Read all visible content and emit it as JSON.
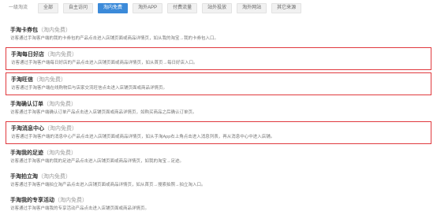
{
  "tabs": [
    {
      "label": "一级淘流",
      "active": false
    },
    {
      "label": "全部",
      "active": false
    },
    {
      "label": "自主访问",
      "active": false
    },
    {
      "label": "淘内免费",
      "active": true
    },
    {
      "label": "淘外APP",
      "active": false
    },
    {
      "label": "付费流量",
      "active": false
    },
    {
      "label": "站外投放",
      "active": false
    },
    {
      "label": "淘外网站",
      "active": false
    },
    {
      "label": "其它来源",
      "active": false
    }
  ],
  "items": [
    {
      "title": "手淘卡券包",
      "tag": "（淘内免费）",
      "desc": "访客通过手淘客户端的我的卡券包的产品点击进入店铺页面或商品详情页，如从我的淘宝→我的卡券包入口。",
      "highlighted": false
    },
    {
      "title": "手淘每日好店",
      "tag": "（淘内免费）",
      "desc": "访客通过手淘客户端每日好店的产品点击进入店铺页面或商品详情页，如从首页→每日好店入口。",
      "highlighted": true
    },
    {
      "title": "手淘旺信",
      "tag": "（淘内免费）",
      "desc": "访客通过手淘客户端在线购物后与店家交流旺信点击进入店铺页面或商品详情页。",
      "highlighted": true
    },
    {
      "title": "手淘确认订单",
      "tag": "（淘内免费）",
      "desc": "访客通过手淘客户端确认订单产品点击进入店铺页面或商品详情页，如购买商品之后确认订单页。",
      "highlighted": false
    },
    {
      "title": "手淘消息中心",
      "tag": "（淘内免费）",
      "desc": "访客通过手淘客户端的消息中心产品点击进入店铺页面或商品详情页，如从手淘App右上角点击进入消息列表，再从消息中心中进入店铺。",
      "highlighted": true
    },
    {
      "title": "手淘我的足迹",
      "tag": "（淘内免费）",
      "desc": "访客通过手淘客户端的我的足迹产品点击进入店铺页面或商品详情页，如我的淘宝→足迹。",
      "highlighted": false
    },
    {
      "title": "手淘拍立淘",
      "tag": "（淘内免费）",
      "desc": "访客通过手淘客户端拍立淘产品点击进入店铺页面或商品详情页，如从首页→搜索拍照→拍立淘入口。",
      "highlighted": false
    },
    {
      "title": "手淘我的专享活动",
      "tag": "（淘内免费）",
      "desc": "访客通过手淘客户端我的专享活动产品点击进入店铺页面或商品详情页。",
      "highlighted": false
    }
  ]
}
